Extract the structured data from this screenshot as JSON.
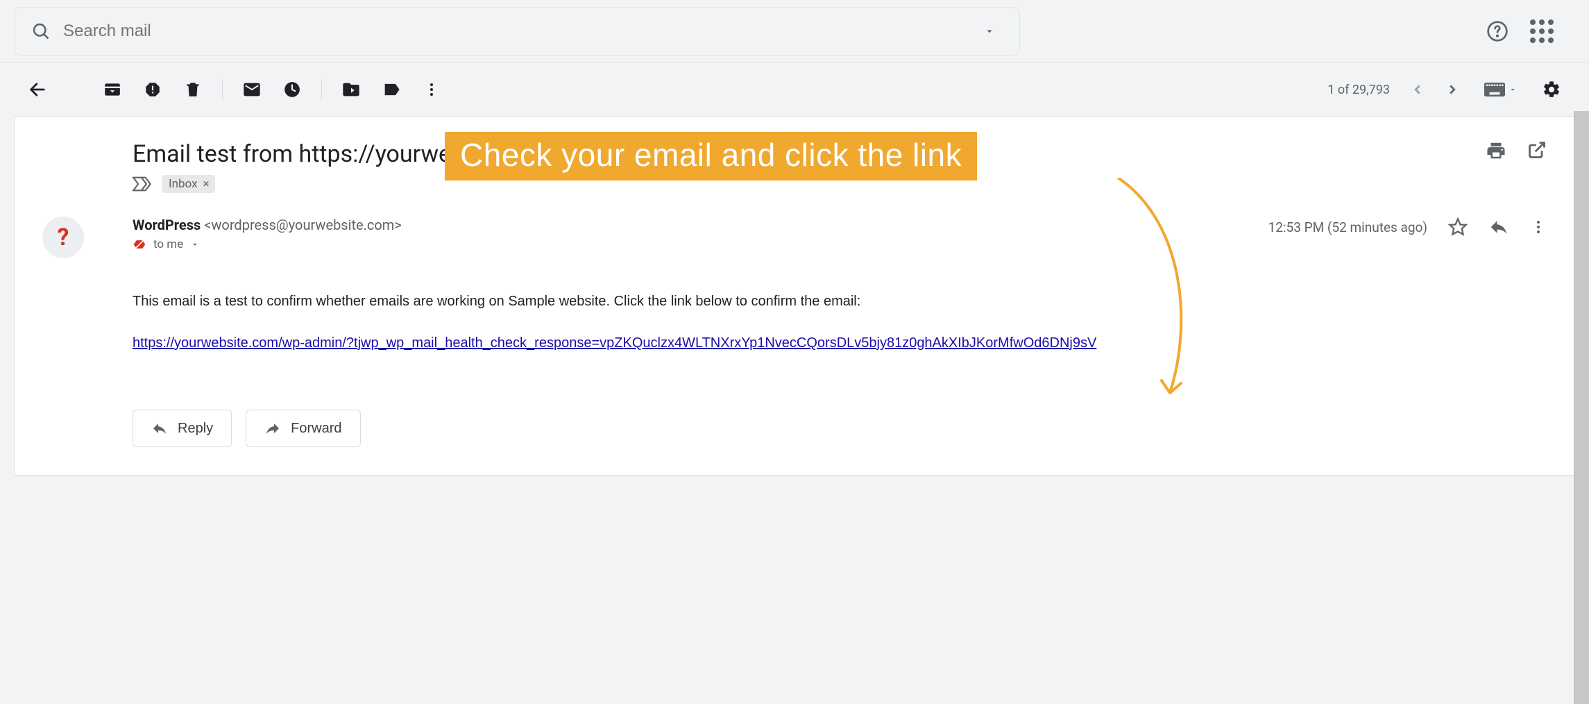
{
  "search": {
    "placeholder": "Search mail"
  },
  "toolbar": {
    "thread_position": "1 of 29,793"
  },
  "message": {
    "subject": "Email test from https://yourwebsite.com",
    "label": "Inbox",
    "sender_name": "WordPress",
    "sender_addr": "<wordpress@yourwebsite.com>",
    "recipient_line": "to me",
    "time": "12:53 PM (52 minutes ago)",
    "body_intro": "This email is a test to confirm whether emails are working on Sample website. Click the link below to confirm the email:",
    "body_link": "https://yourwebsite.com/wp-admin/?tjwp_wp_mail_health_check_response=vpZKQuclzx4WLTNXrxYp1NvecCQorsDLv5bjy81z0ghAkXIbJKorMfwOd6DNj9sV",
    "reply_label": "Reply",
    "forward_label": "Forward"
  },
  "annotation": {
    "text": "Check your email and click the link"
  }
}
